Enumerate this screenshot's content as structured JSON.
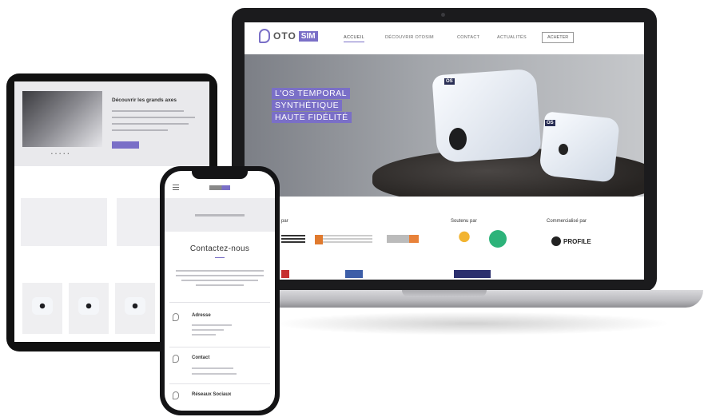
{
  "laptop": {
    "logo_text": "OTO",
    "logo_badge": "SIM",
    "logo_tagline": "",
    "nav": [
      "ACCUEIL",
      "DÉCOUVRIR OTOSIM",
      "CONTACT",
      "ACTUALITÉS"
    ],
    "nav_cta": "ACHETER",
    "hero": {
      "kicker": "",
      "title_lines": [
        "L'OS TEMPORAL",
        "SYNTHÉTIQUE",
        "HAUTE FIDÉLITÉ"
      ],
      "description": "",
      "tag_big": "OS",
      "tag_small": "OS"
    },
    "partners": {
      "col1_title": "par",
      "col2_title": "Soutenu par",
      "col3_title": "Commercialisé par",
      "col3_logo": "PROFILE"
    }
  },
  "tablet": {
    "headline": "Découvrir les grands axes",
    "dots": "• • • • •",
    "section_title": "",
    "products_title": ""
  },
  "phone": {
    "title": "Contactez-nous",
    "items": [
      {
        "label": "Adresse",
        "icon": "location-pin-icon"
      },
      {
        "label": "Contact",
        "icon": "phone-icon"
      },
      {
        "label": "Réseaux Sociaux",
        "icon": "share-icon"
      }
    ]
  },
  "colors": {
    "accent": "#7a6fc7",
    "device_frame": "#1b1b1d",
    "hero_gray": "#a3a6ab"
  }
}
